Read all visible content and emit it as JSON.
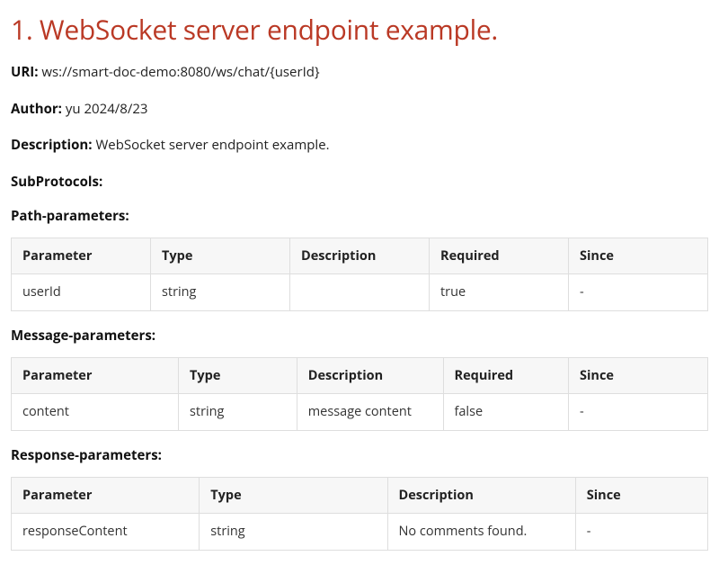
{
  "title": "1. WebSocket server endpoint example.",
  "uri": {
    "label": "URI:",
    "value": "ws://smart-doc-demo:8080/ws/chat/{userId}"
  },
  "author": {
    "label": "Author:",
    "value": "yu 2024/8/23"
  },
  "description": {
    "label": "Description:",
    "value": "WebSocket server endpoint example."
  },
  "subprotocols": {
    "label": "SubProtocols:"
  },
  "path_params": {
    "heading": "Path-parameters:",
    "columns": [
      "Parameter",
      "Type",
      "Description",
      "Required",
      "Since"
    ],
    "rows": [
      {
        "parameter": "userId",
        "type": "string",
        "description": "",
        "required": "true",
        "since": "-"
      }
    ]
  },
  "message_params": {
    "heading": "Message-parameters:",
    "columns": [
      "Parameter",
      "Type",
      "Description",
      "Required",
      "Since"
    ],
    "rows": [
      {
        "parameter": "content",
        "type": "string",
        "description": "message content",
        "required": "false",
        "since": "-"
      }
    ]
  },
  "response_params": {
    "heading": "Response-parameters:",
    "columns": [
      "Parameter",
      "Type",
      "Description",
      "Since"
    ],
    "rows": [
      {
        "parameter": "responseContent",
        "type": "string",
        "description": "No comments found.",
        "since": "-"
      }
    ]
  }
}
